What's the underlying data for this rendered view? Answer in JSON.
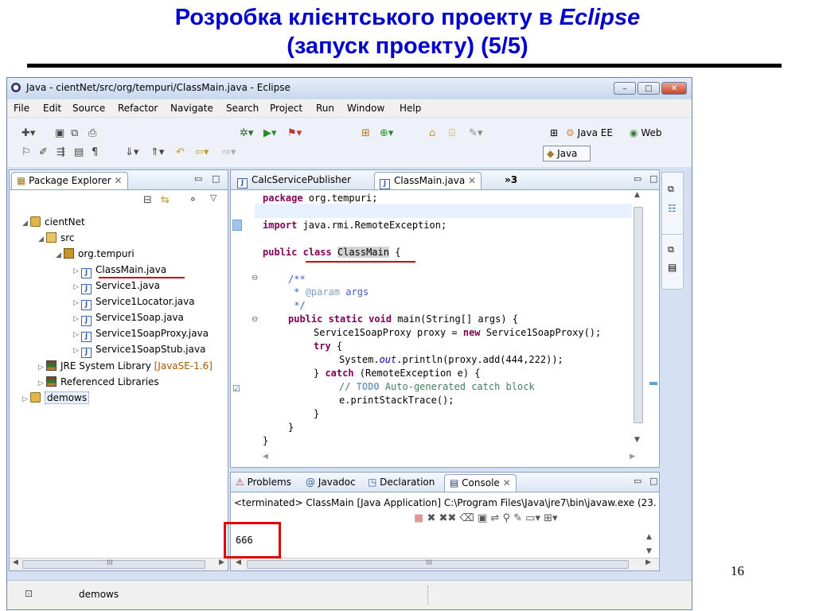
{
  "slide": {
    "title_line1": "Розробка клієнтського проекту в ",
    "title_italic": "Eclipse",
    "title_line2": "(запуск проекту)    (5/5)",
    "page_number": "16"
  },
  "window": {
    "title": "Java - cientNet/src/org/tempuri/ClassMain.java - Eclipse",
    "controls": {
      "minimize": "–",
      "maximize": "□",
      "close": "✕"
    }
  },
  "menu": [
    "File",
    "Edit",
    "Source",
    "Refactor",
    "Navigate",
    "Search",
    "Project",
    "Run",
    "Window",
    "Help"
  ],
  "toolbar": {
    "perspective_java_ee": "Java EE",
    "perspective_web": "Web",
    "perspective_java": "Java"
  },
  "package_explorer": {
    "tab_label": "Package Explorer",
    "tree": [
      {
        "label": "cientNet",
        "icon": "project-icon"
      },
      {
        "label": "src",
        "icon": "source-folder-icon"
      },
      {
        "label": "org.tempuri",
        "icon": "package-icon"
      },
      {
        "label": "ClassMain.java",
        "icon": "java-file-icon"
      },
      {
        "label": "Service1.java",
        "icon": "java-file-icon"
      },
      {
        "label": "Service1Locator.java",
        "icon": "java-file-icon"
      },
      {
        "label": "Service1Soap.java",
        "icon": "java-file-icon"
      },
      {
        "label": "Service1SoapProxy.java",
        "icon": "java-file-icon"
      },
      {
        "label": "Service1SoapStub.java",
        "icon": "java-file-icon"
      },
      {
        "label": "JRE System Library",
        "suffix": "[JavaSE-1.6]",
        "icon": "library-icon"
      },
      {
        "label": "Referenced Libraries",
        "icon": "library-icon"
      },
      {
        "label": "demows",
        "icon": "project-icon"
      }
    ]
  },
  "editor": {
    "tabs": [
      "CalcServicePublisher",
      "ClassMain.java",
      "»3"
    ],
    "code": {
      "l1_kw": "package",
      "l1_rest": " org.tempuri;",
      "l2_kw": "import",
      "l2_rest": " java.rmi.RemoteException;",
      "l3_kw1": "public",
      "l3_kw2": "class",
      "l3_name": "ClassMain",
      "l3_rest": " {",
      "l4": "/**",
      "l5_star": " * ",
      "l5_ann": "@param",
      "l5_rest": " args",
      "l6": " */",
      "l7_kw": "public static void",
      "l7_rest": " main(String[] args) {",
      "l8_a": "Service1SoapProxy proxy = ",
      "l8_kw": "new",
      "l8_b": " Service1SoapProxy();",
      "l9_kw": "try",
      "l9_rest": " {",
      "l10_a": "System.",
      "l10_it": "out",
      "l10_b": ".println(proxy.add(444,222));",
      "l11_a": "} ",
      "l11_kw": "catch",
      "l11_b": " (RemoteException e) {",
      "l12_a": "// ",
      "l12_todo": "TODO",
      "l12_b": " Auto-generated catch block",
      "l13": "e.printStackTrace();",
      "l14": "}",
      "l15": "}",
      "l16": "}"
    }
  },
  "bottom_panel": {
    "tabs": [
      "Problems",
      "Javadoc",
      "Declaration",
      "Console"
    ],
    "terminated_line": "<terminated> ClassMain [Java Application] C:\\Program Files\\Java\\jre7\\bin\\javaw.exe (23.",
    "output": "666"
  },
  "status": {
    "selected": "demows"
  },
  "scroll_glyph": "III"
}
